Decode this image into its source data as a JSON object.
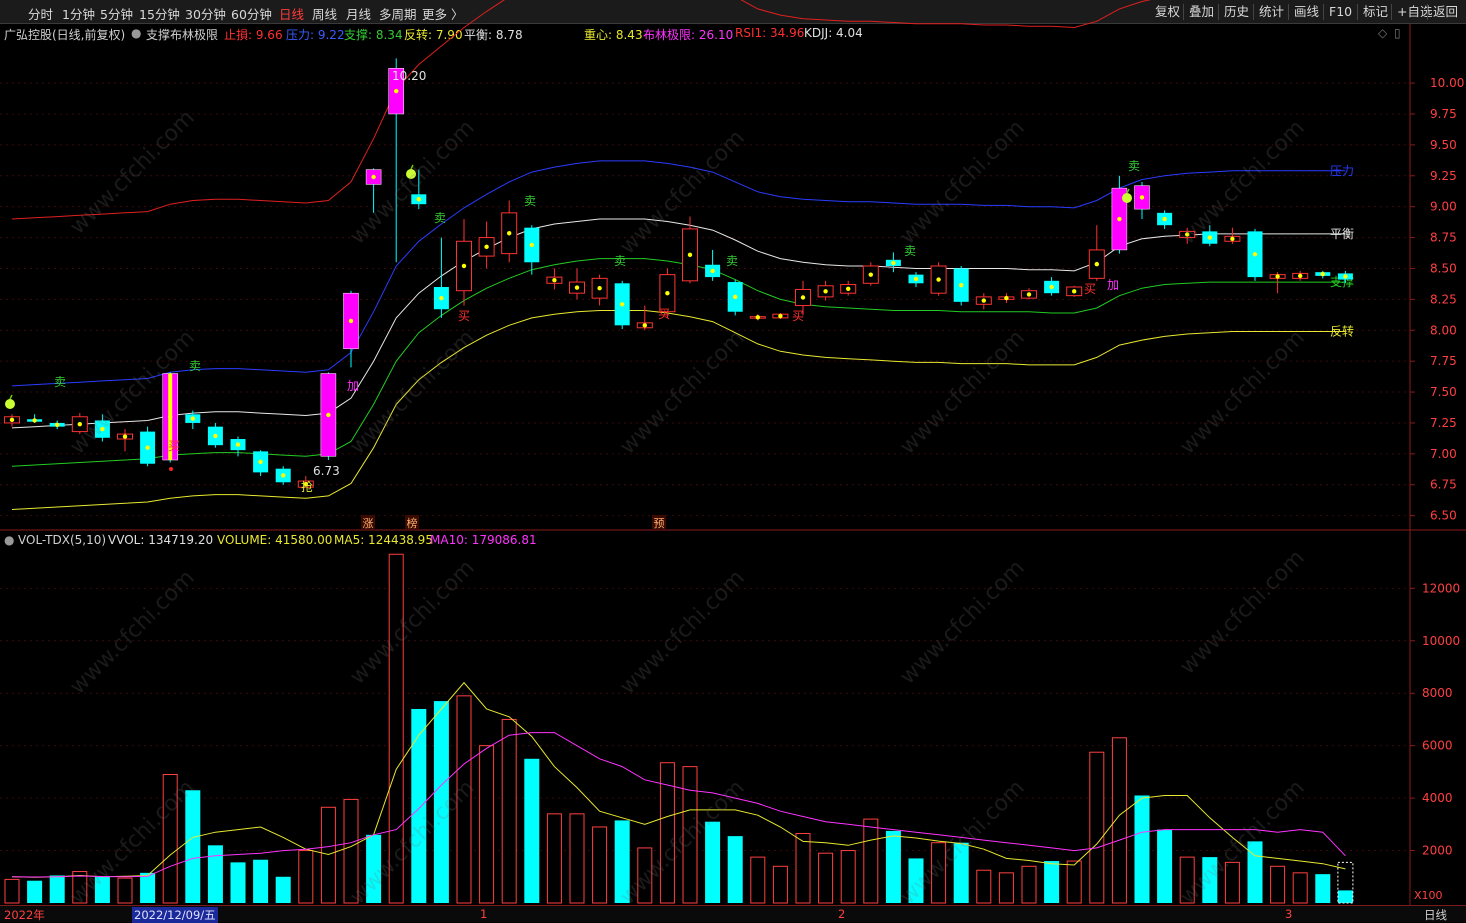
{
  "toolbar": {
    "periods": [
      "分时",
      "1分钟",
      "5分钟",
      "15分钟",
      "30分钟",
      "60分钟",
      "日线",
      "周线",
      "月线",
      "多周期",
      "更多 〉"
    ],
    "active_period": "日线",
    "right_buttons": [
      "复权",
      "叠加",
      "历史",
      "统计",
      "画线",
      "F10",
      "标记",
      "+自选",
      "返回"
    ]
  },
  "legend_main": {
    "stock": "广弘控股(日线,前复权)",
    "indicator": "支撑布林极限",
    "items": [
      {
        "label": "止損: 9.66",
        "color": "#ff3030"
      },
      {
        "label": "压力: 9.22",
        "color": "#3a5cff"
      },
      {
        "label": "支撑: 8.34",
        "color": "#33cc33"
      },
      {
        "label": "反转: 7.90",
        "color": "#e8e830"
      },
      {
        "label": "平衡: 8.78",
        "color": "#e0e0e0"
      },
      {
        "label": "重心: 8.43",
        "color": "#e8e830"
      },
      {
        "label": "布林极限: 26.10",
        "color": "#ff33ff"
      },
      {
        "label": "RSI1: 34.96",
        "color": "#ff3030"
      },
      {
        "label": "KDJJ: 4.04",
        "color": "#e0e0e0"
      }
    ]
  },
  "legend_vol": {
    "indicator": "VOL-TDX(5,10)",
    "items": [
      {
        "label": "VVOL: 134719.20",
        "color": "#e0e0e0"
      },
      {
        "label": "VOLUME: 41580.00",
        "color": "#e8e830"
      },
      {
        "label": "MA5: 124438.95",
        "color": "#e8e830"
      },
      {
        "label": "MA10: 179086.81",
        "color": "#ff33ff"
      }
    ]
  },
  "price_axis": [
    "10.00",
    "9.75",
    "9.50",
    "9.25",
    "9.00",
    "8.75",
    "8.50",
    "8.25",
    "8.00",
    "7.75",
    "7.50",
    "7.25",
    "7.00",
    "6.75",
    "6.50"
  ],
  "vol_axis": [
    "12000",
    "10000",
    "8000",
    "6000",
    "4000",
    "2000"
  ],
  "vol_unit": "X100",
  "line_labels": {
    "stop": "止損",
    "pressure": "压力",
    "balance": "平衡",
    "support": "支撑",
    "reverse": "反转"
  },
  "annotations": {
    "high_label": "10.20",
    "low_label": "6.73",
    "buy": "买",
    "sell": "卖",
    "add": "加",
    "grab": "抢",
    "events": [
      "涨",
      "榜",
      "预"
    ]
  },
  "time_axis": [
    "2022年",
    "2022/12/09/五",
    "1",
    "2",
    "3"
  ],
  "bottom_right": "日线",
  "watermark": "www.cfchi.com",
  "colors": {
    "up": "#ff3232",
    "down": "#00ffff",
    "dot": "#ffff00",
    "special": "#ff00ff"
  },
  "chart_data": {
    "type": "candlestick",
    "price_ylim": [
      6.4,
      10.3
    ],
    "volume_ylim": [
      0,
      13500
    ],
    "candles": [
      [
        7.25,
        7.3,
        7.22,
        7.32
      ],
      [
        7.28,
        7.26,
        7.25,
        7.32
      ],
      [
        7.25,
        7.22,
        7.2,
        7.27
      ],
      [
        7.18,
        7.3,
        7.16,
        7.33
      ],
      [
        7.27,
        7.13,
        7.1,
        7.32
      ],
      [
        7.12,
        7.16,
        7.02,
        7.2
      ],
      [
        7.18,
        6.92,
        6.9,
        7.22
      ],
      [
        6.95,
        7.65,
        6.93,
        7.66
      ],
      [
        7.32,
        7.25,
        7.2,
        7.35
      ],
      [
        7.22,
        7.07,
        7.05,
        7.25
      ],
      [
        7.12,
        7.03,
        6.98,
        7.14
      ],
      [
        7.02,
        6.85,
        6.82,
        7.03
      ],
      [
        6.88,
        6.77,
        6.75,
        6.9
      ],
      [
        6.73,
        6.78,
        6.73,
        6.82
      ],
      [
        6.98,
        7.65,
        6.95,
        7.66
      ],
      [
        7.85,
        8.3,
        7.7,
        8.32
      ],
      [
        9.3,
        9.18,
        8.95,
        9.31
      ],
      [
        9.75,
        10.12,
        8.55,
        10.2
      ],
      [
        9.1,
        9.02,
        8.98,
        9.3
      ],
      [
        8.35,
        8.17,
        8.1,
        8.75
      ],
      [
        8.32,
        8.72,
        8.2,
        8.9
      ],
      [
        8.6,
        8.75,
        8.5,
        8.88
      ],
      [
        8.62,
        8.95,
        8.55,
        9.05
      ],
      [
        8.83,
        8.55,
        8.45,
        8.85
      ],
      [
        8.38,
        8.43,
        8.33,
        8.5
      ],
      [
        8.3,
        8.39,
        8.25,
        8.5
      ],
      [
        8.26,
        8.42,
        8.2,
        8.45
      ],
      [
        8.38,
        8.04,
        8.01,
        8.4
      ],
      [
        8.02,
        8.06,
        8.0,
        8.2
      ],
      [
        8.15,
        8.45,
        8.1,
        8.5
      ],
      [
        8.4,
        8.82,
        8.38,
        8.92
      ],
      [
        8.53,
        8.43,
        8.4,
        8.65
      ],
      [
        8.39,
        8.15,
        8.12,
        8.41
      ],
      [
        8.1,
        8.11,
        8.08,
        8.13
      ],
      [
        8.1,
        8.13,
        8.09,
        8.14
      ],
      [
        8.2,
        8.33,
        8.12,
        8.4
      ],
      [
        8.27,
        8.36,
        8.24,
        8.4
      ],
      [
        8.3,
        8.37,
        8.28,
        8.4
      ],
      [
        8.38,
        8.52,
        8.36,
        8.55
      ],
      [
        8.57,
        8.52,
        8.47,
        8.63
      ],
      [
        8.45,
        8.38,
        8.35,
        8.47
      ],
      [
        8.3,
        8.52,
        8.28,
        8.55
      ],
      [
        8.5,
        8.23,
        8.2,
        8.52
      ],
      [
        8.21,
        8.27,
        8.17,
        8.3
      ],
      [
        8.25,
        8.27,
        8.22,
        8.3
      ],
      [
        8.26,
        8.32,
        8.25,
        8.34
      ],
      [
        8.4,
        8.3,
        8.28,
        8.43
      ],
      [
        8.28,
        8.35,
        8.27,
        8.36
      ],
      [
        8.42,
        8.65,
        8.4,
        8.85
      ],
      [
        8.65,
        9.15,
        8.62,
        9.25
      ],
      [
        9.17,
        8.98,
        8.9,
        9.2
      ],
      [
        8.95,
        8.85,
        8.82,
        8.97
      ],
      [
        8.75,
        8.8,
        8.7,
        8.83
      ],
      [
        8.8,
        8.7,
        8.68,
        8.85
      ],
      [
        8.72,
        8.76,
        8.7,
        8.83
      ],
      [
        8.8,
        8.43,
        8.4,
        8.82
      ],
      [
        8.42,
        8.45,
        8.3,
        8.47
      ],
      [
        8.42,
        8.46,
        8.4,
        8.48
      ],
      [
        8.47,
        8.44,
        8.42,
        8.48
      ],
      [
        8.46,
        8.41,
        8.38,
        8.48
      ]
    ],
    "volume": [
      900,
      850,
      1050,
      1200,
      1000,
      950,
      1150,
      4900,
      4300,
      2200,
      1550,
      1650,
      1000,
      2000,
      3650,
      3950,
      2600,
      13300,
      7400,
      7700,
      7900,
      6000,
      7000,
      5500,
      3400,
      3400,
      2900,
      3150,
      2100,
      5350,
      5200,
      3100,
      2550,
      1750,
      1400,
      2650,
      1900,
      2000,
      3200,
      2750,
      1700,
      2300,
      2300,
      1250,
      1150,
      1400,
      1600,
      1600,
      5750,
      6300,
      4100,
      2800,
      1750,
      1750,
      1550,
      2350,
      1400,
      1150,
      1100,
      480
    ],
    "series": [
      {
        "name": "止損",
        "values": [
          8.9,
          8.91,
          8.92,
          8.93,
          8.94,
          8.95,
          8.96,
          9.02,
          9.05,
          9.06,
          9.06,
          9.05,
          9.04,
          9.03,
          9.05,
          9.2,
          9.55,
          9.95,
          10.15,
          10.3,
          10.45,
          10.58,
          10.7,
          10.8,
          10.85,
          10.88,
          10.9,
          10.9,
          10.9,
          10.88,
          10.85,
          10.8,
          10.7,
          10.6,
          10.55,
          10.52,
          10.51,
          10.5,
          10.5,
          10.49,
          10.48,
          10.48,
          10.48,
          10.47,
          10.47,
          10.46,
          10.46,
          10.45,
          10.5,
          10.6,
          10.66,
          10.7,
          10.72,
          10.74,
          10.75,
          10.75,
          10.75,
          10.75,
          10.75,
          10.75
        ]
      },
      {
        "name": "压力",
        "values": [
          7.55,
          7.56,
          7.57,
          7.58,
          7.59,
          7.6,
          7.61,
          7.66,
          7.68,
          7.69,
          7.69,
          7.68,
          7.67,
          7.66,
          7.68,
          7.82,
          8.15,
          8.52,
          8.72,
          8.86,
          8.99,
          9.1,
          9.2,
          9.28,
          9.32,
          9.35,
          9.37,
          9.37,
          9.37,
          9.35,
          9.32,
          9.28,
          9.2,
          9.12,
          9.08,
          9.06,
          9.05,
          9.04,
          9.04,
          9.03,
          9.02,
          9.02,
          9.02,
          9.01,
          9.01,
          9.0,
          9.0,
          8.99,
          9.05,
          9.15,
          9.22,
          9.25,
          9.27,
          9.28,
          9.29,
          9.29,
          9.29,
          9.29,
          9.29,
          9.29
        ]
      },
      {
        "name": "平衡",
        "values": [
          7.21,
          7.22,
          7.23,
          7.24,
          7.25,
          7.26,
          7.27,
          7.31,
          7.33,
          7.34,
          7.34,
          7.33,
          7.32,
          7.31,
          7.33,
          7.45,
          7.75,
          8.1,
          8.3,
          8.44,
          8.56,
          8.66,
          8.75,
          8.82,
          8.86,
          8.88,
          8.9,
          8.9,
          8.9,
          8.88,
          8.85,
          8.81,
          8.73,
          8.64,
          8.58,
          8.55,
          8.53,
          8.52,
          8.52,
          8.51,
          8.5,
          8.5,
          8.5,
          8.5,
          8.5,
          8.49,
          8.49,
          8.48,
          8.55,
          8.68,
          8.74,
          8.76,
          8.77,
          8.78,
          8.78,
          8.78,
          8.78,
          8.78,
          8.78,
          8.78
        ]
      },
      {
        "name": "支撑",
        "values": [
          6.9,
          6.91,
          6.92,
          6.93,
          6.94,
          6.95,
          6.96,
          6.99,
          7.0,
          7.01,
          7.01,
          7.0,
          6.99,
          6.98,
          7.0,
          7.1,
          7.4,
          7.75,
          7.98,
          8.12,
          8.24,
          8.34,
          8.42,
          8.49,
          8.53,
          8.56,
          8.58,
          8.58,
          8.58,
          8.56,
          8.53,
          8.49,
          8.41,
          8.32,
          8.25,
          8.21,
          8.19,
          8.18,
          8.17,
          8.16,
          8.16,
          8.16,
          8.15,
          8.15,
          8.15,
          8.15,
          8.14,
          8.14,
          8.18,
          8.28,
          8.34,
          8.37,
          8.38,
          8.39,
          8.39,
          8.39,
          8.39,
          8.39,
          8.39,
          8.39
        ]
      },
      {
        "name": "反转",
        "values": [
          6.55,
          6.56,
          6.57,
          6.58,
          6.59,
          6.6,
          6.61,
          6.64,
          6.66,
          6.67,
          6.67,
          6.66,
          6.65,
          6.64,
          6.66,
          6.76,
          7.05,
          7.4,
          7.6,
          7.74,
          7.86,
          7.96,
          8.04,
          8.1,
          8.13,
          8.15,
          8.16,
          8.16,
          8.16,
          8.14,
          8.11,
          8.07,
          7.98,
          7.89,
          7.83,
          7.8,
          7.78,
          7.77,
          7.76,
          7.75,
          7.74,
          7.74,
          7.73,
          7.73,
          7.73,
          7.72,
          7.72,
          7.72,
          7.78,
          7.88,
          7.92,
          7.95,
          7.97,
          7.98,
          7.99,
          7.99,
          7.99,
          7.99,
          7.99,
          7.99
        ]
      },
      {
        "name": "MA5",
        "values": [
          1000,
          980,
          1000,
          1050,
          1000,
          1020,
          1050,
          1830,
          2500,
          2700,
          2800,
          2900,
          2500,
          2050,
          1850,
          2150,
          2600,
          5100,
          6400,
          7400,
          8400,
          7400,
          7100,
          6350,
          5200,
          4400,
          3500,
          3250,
          3000,
          3300,
          3550,
          3550,
          3550,
          3350,
          2900,
          2350,
          2300,
          2200,
          2400,
          2560,
          2480,
          2360,
          2270,
          2050,
          1700,
          1620,
          1500,
          1450,
          2250,
          3350,
          4000,
          4100,
          4100,
          3250,
          2500,
          1800,
          1700,
          1600,
          1500,
          1300
        ]
      },
      {
        "name": "MA10",
        "values": [
          1000,
          990,
          1000,
          1030,
          1010,
          1000,
          1020,
          1400,
          1700,
          1800,
          1850,
          1900,
          2000,
          2050,
          2150,
          2300,
          2600,
          2800,
          3600,
          4500,
          5300,
          5900,
          6400,
          6500,
          6500,
          6000,
          5500,
          5200,
          4700,
          4500,
          4300,
          4200,
          4000,
          3800,
          3500,
          3300,
          3100,
          3000,
          2900,
          2800,
          2700,
          2600,
          2500,
          2400,
          2300,
          2200,
          2100,
          2000,
          2100,
          2400,
          2700,
          2800,
          2800,
          2800,
          2800,
          2800,
          2700,
          2800,
          2700,
          1800
        ]
      }
    ]
  }
}
